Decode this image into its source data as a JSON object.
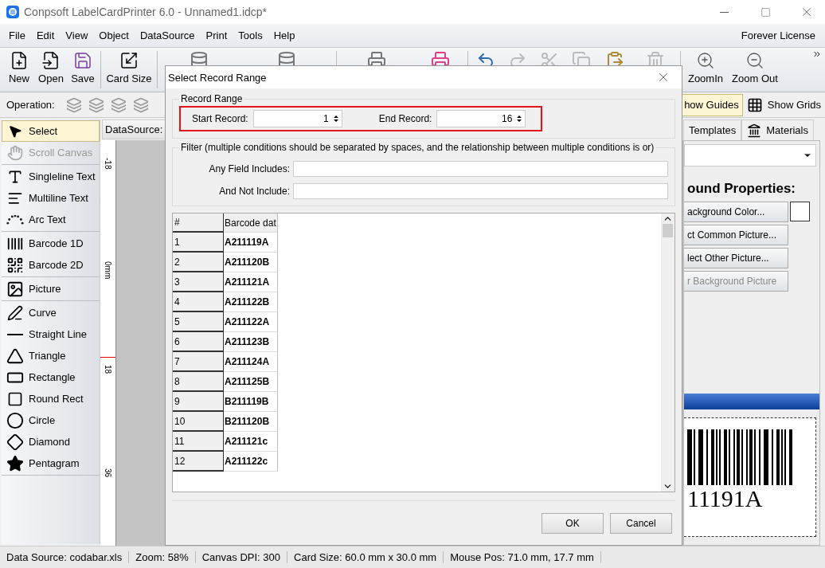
{
  "window": {
    "title": "Conpsoft LabelCardPrinter 6.0 - Unnamed1.idcp*"
  },
  "menu": [
    "File",
    "Edit",
    "View",
    "Object",
    "DataSource",
    "Print",
    "Tools",
    "Help"
  ],
  "license": "Forever License",
  "toolbar": {
    "file_buttons": [
      "New",
      "Open",
      "Save"
    ],
    "card_button": "Card Size",
    "zoom_buttons": [
      "ZoomIn",
      "Zoom Out"
    ]
  },
  "operation_label": "Operation:",
  "view_toggles": [
    {
      "label": "how Guides",
      "on": true
    },
    {
      "label": "Show Grids",
      "on": false
    }
  ],
  "tools": [
    {
      "items": [
        {
          "label": "Select",
          "selected": true,
          "disabled": false
        },
        {
          "label": "Scroll Canvas",
          "selected": false,
          "disabled": true
        }
      ]
    },
    {
      "items": [
        {
          "label": "Singleline Text",
          "selected": false,
          "disabled": false
        },
        {
          "label": "Multiline Text",
          "selected": false,
          "disabled": false
        },
        {
          "label": "Arc Text",
          "selected": false,
          "disabled": false
        }
      ]
    },
    {
      "items": [
        {
          "label": "Barcode 1D",
          "selected": false,
          "disabled": false
        },
        {
          "label": "Barcode 2D",
          "selected": false,
          "disabled": false
        }
      ]
    },
    {
      "items": [
        {
          "label": "Picture",
          "selected": false,
          "disabled": false
        }
      ]
    },
    {
      "items": [
        {
          "label": "Curve",
          "selected": false,
          "disabled": false
        },
        {
          "label": "Straight Line",
          "selected": false,
          "disabled": false
        },
        {
          "label": "Triangle",
          "selected": false,
          "disabled": false
        },
        {
          "label": "Rectangle",
          "selected": false,
          "disabled": false
        },
        {
          "label": "Round Rect",
          "selected": false,
          "disabled": false
        },
        {
          "label": "Circle",
          "selected": false,
          "disabled": false
        },
        {
          "label": "Diamond",
          "selected": false,
          "disabled": false
        },
        {
          "label": "Pentagram",
          "selected": false,
          "disabled": false
        }
      ]
    }
  ],
  "datasource_label": "DataSource:",
  "ruler_labels": [
    "-18",
    "0mm",
    "18",
    "36"
  ],
  "right_panel": {
    "tabs": [
      "Templates",
      "Materials"
    ],
    "heading": "ound Properties:",
    "buttons": [
      {
        "label": "ackground Color...",
        "disabled": false
      },
      {
        "label": "ct Common Picture...",
        "disabled": false
      },
      {
        "label": "lect Other Picture...",
        "disabled": false
      },
      {
        "label": "r Background Picture",
        "disabled": true
      }
    ],
    "preview_text": "11191A"
  },
  "dialog": {
    "title": "Select Record Range",
    "range_group": {
      "title": "Record Range",
      "spinners": [
        {
          "label": "Start Record:",
          "value": "1"
        },
        {
          "label": "End Record:",
          "value": "16"
        }
      ]
    },
    "filter_group": {
      "title": "Filter (multiple conditions should be separated by spaces, and the relationship between multiple conditions is or)",
      "fields": [
        {
          "label": "Any Field Includes:"
        },
        {
          "label": "And Not Include:"
        }
      ]
    },
    "table": {
      "columns": [
        "#",
        "Barcode dat"
      ],
      "rows": [
        [
          "1",
          "A211119A"
        ],
        [
          "2",
          "A211120B"
        ],
        [
          "3",
          "A211121A"
        ],
        [
          "4",
          "A211122B"
        ],
        [
          "5",
          "A211122A"
        ],
        [
          "6",
          "A211123B"
        ],
        [
          "7",
          "A211124A"
        ],
        [
          "8",
          "A211125B"
        ],
        [
          "9",
          "B211119B"
        ],
        [
          "10",
          "B211120B"
        ],
        [
          "11",
          "A211121c"
        ],
        [
          "12",
          "A211122c"
        ]
      ]
    },
    "buttons": [
      "OK",
      "Cancel"
    ]
  },
  "status_bar": [
    "Data Source: codabar.xls",
    "Zoom: 58%",
    "Canvas DPI: 300",
    "Card Size: 60.0 mm x 30.0 mm",
    "Mouse Pos: 71.0 mm, 17.7 mm"
  ]
}
